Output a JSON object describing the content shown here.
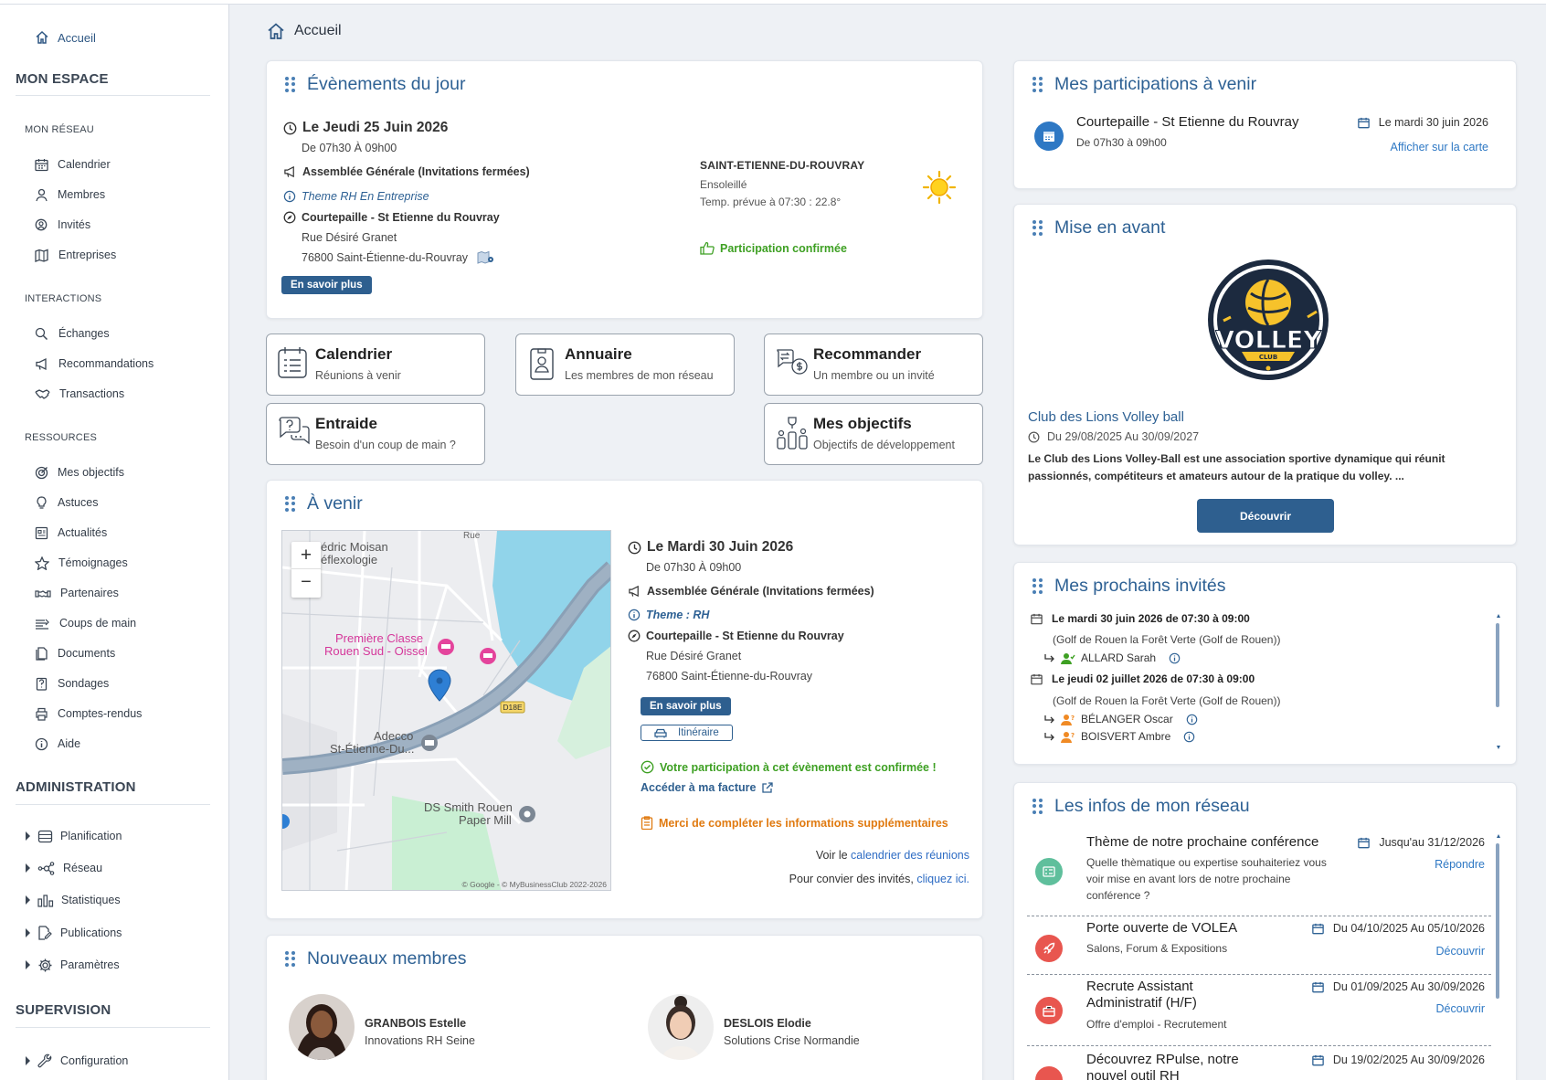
{
  "sidebar": {
    "home": "Accueil",
    "mon_espace": "MON ESPACE",
    "mon_reseau": "MON RÉSEAU",
    "reseau_items": [
      "Calendrier",
      "Membres",
      "Invités",
      "Entreprises"
    ],
    "interactions": "INTERACTIONS",
    "interactions_items": [
      "Échanges",
      "Recommandations",
      "Transactions"
    ],
    "ressources": "RESSOURCES",
    "ressources_items": [
      "Mes objectifs",
      "Astuces",
      "Actualités",
      "Témoignages",
      "Partenaires",
      "Coups de main",
      "Documents",
      "Sondages",
      "Comptes-rendus",
      "Aide"
    ],
    "administration": "ADMINISTRATION",
    "admin_items": [
      "Planification",
      "Réseau",
      "Statistiques",
      "Publications",
      "Paramètres"
    ],
    "supervision": "SUPERVISION",
    "supervision_items": [
      "Configuration"
    ]
  },
  "breadcrumb": "Accueil",
  "events": {
    "title": "Évènements du jour",
    "date": "Le Jeudi 25 Juin 2026",
    "time": "De 07h30 À 09h00",
    "type": "Assemblée Générale (Invitations fermées)",
    "theme": "Theme RH En Entreprise",
    "venue": "Courtepaille - St Etienne du Rouvray",
    "street": "Rue Désiré Granet",
    "city": "76800 Saint-Étienne-du-Rouvray",
    "button": "En savoir plus",
    "weather_city": "SAINT-ETIENNE-DU-ROUVRAY",
    "weather_state": "Ensoleillé",
    "weather_temp": "Temp. prévue à 07:30 : 22.8°",
    "participation": "Participation confirmée"
  },
  "tiles": [
    {
      "title": "Calendrier",
      "sub": "Réunions à venir"
    },
    {
      "title": "Annuaire",
      "sub": "Les membres de mon réseau"
    },
    {
      "title": "Recommander",
      "sub": "Un membre ou un invité"
    },
    {
      "title": "Entraide",
      "sub": "Besoin d'un coup de main ?"
    },
    {
      "title": "Mes objectifs",
      "sub": "Objectifs de développement"
    }
  ],
  "upcoming": {
    "title": "À venir",
    "date": "Le Mardi 30 Juin 2026",
    "time": "De 07h30 À 09h00",
    "type": "Assemblée Générale (Invitations fermées)",
    "theme": "Theme : RH",
    "venue": "Courtepaille - St Etienne du Rouvray",
    "street": "Rue Désiré Granet",
    "city": "76800 Saint-Étienne-du-Rouvray",
    "button": "En savoir plus",
    "itinerary": "Itinéraire",
    "confirmed": "Votre participation à cet évènement est confirmée !",
    "invoice": "Accéder à ma facture",
    "warning": "Merci de compléter les informations supplémentaires",
    "see_prefix": "Voir le ",
    "see_link": "calendrier des réunions",
    "invite_prefix": "Pour convier des invités, ",
    "invite_link": "cliquez ici.",
    "map": {
      "zoom_in": "+",
      "zoom_out": "−",
      "label_moisan": "édric Moisan",
      "label_reflex": "éflexologie",
      "label_rue": "Rue",
      "label_hotel1": "Première Classe",
      "label_hotel2": "Rouen Sud - Oissel",
      "label_adecco1": "Adecco",
      "label_adecco2": "St-Étienne-Du...",
      "label_ds1": "DS Smith Rouen",
      "label_ds2": "Paper Mill",
      "road": "D18E",
      "credit": "© Google - © MyBusinessClub 2022-2026"
    }
  },
  "new_members": {
    "title": "Nouveaux membres",
    "members": [
      {
        "name": "GRANBOIS Estelle",
        "company": "Innovations RH Seine"
      },
      {
        "name": "DESLOIS Elodie",
        "company": "Solutions Crise Normandie"
      }
    ]
  },
  "participations": {
    "title": "Mes participations à venir",
    "event": "Courtepaille - St Etienne du Rouvray",
    "time": "De 07h30 à 09h00",
    "date": "Le mardi 30 juin 2026",
    "map_link": "Afficher sur la carte"
  },
  "featured": {
    "title": "Mise en avant",
    "logo_text": "VOLLEY",
    "logo_sub": "CLUB",
    "club": "Club des Lions Volley ball",
    "dates": "Du 29/08/2025 Au 30/09/2027",
    "desc": "Le Club des Lions Volley-Ball est une association sportive dynamique qui réunit passionnés, compétiteurs et amateurs autour de la pratique du volley. ...",
    "button": "Découvrir"
  },
  "guests": {
    "title": "Mes prochains invités",
    "groups": [
      {
        "date": "Le mardi 30 juin 2026 de 07:30 à 09:00",
        "place": "(Golf de Rouen la Forêt Verte (Golf de Rouen))",
        "people": [
          "ALLARD Sarah"
        ]
      },
      {
        "date": "Le jeudi 02 juillet 2026 de 07:30 à 09:00",
        "place": "(Golf de Rouen la Forêt Verte (Golf de Rouen))",
        "people": [
          "BÉLANGER Oscar",
          "BOISVERT Ambre"
        ]
      }
    ]
  },
  "network": {
    "title": "Les infos de mon réseau",
    "items": [
      {
        "title": "Thème de notre prochaine conférence",
        "date": "Jusqu'au 31/12/2026",
        "desc": "Quelle thèmatique ou expertise souhaiteriez vous voir mise en avant lors de notre prochaine conférence ?",
        "action": "Répondre",
        "color": "#5fbf9c"
      },
      {
        "title": "Porte ouverte de VOLEA",
        "date": "Du 04/10/2025 Au 05/10/2026",
        "desc": "Salons, Forum & Expositions",
        "action": "Découvrir",
        "color": "#e8564f"
      },
      {
        "title": "Recrute Assistant Administratif (H/F)",
        "date": "Du 01/09/2025 Au 30/09/2026",
        "desc": "Offre d'emploi - Recrutement",
        "action": "Découvrir",
        "color": "#e8564f"
      },
      {
        "title": "Découvrez RPulse, notre nouvel outil RH",
        "date": "Du 19/02/2025 Au 30/09/2026",
        "desc": "",
        "action": "",
        "color": "#e8564f"
      }
    ]
  }
}
